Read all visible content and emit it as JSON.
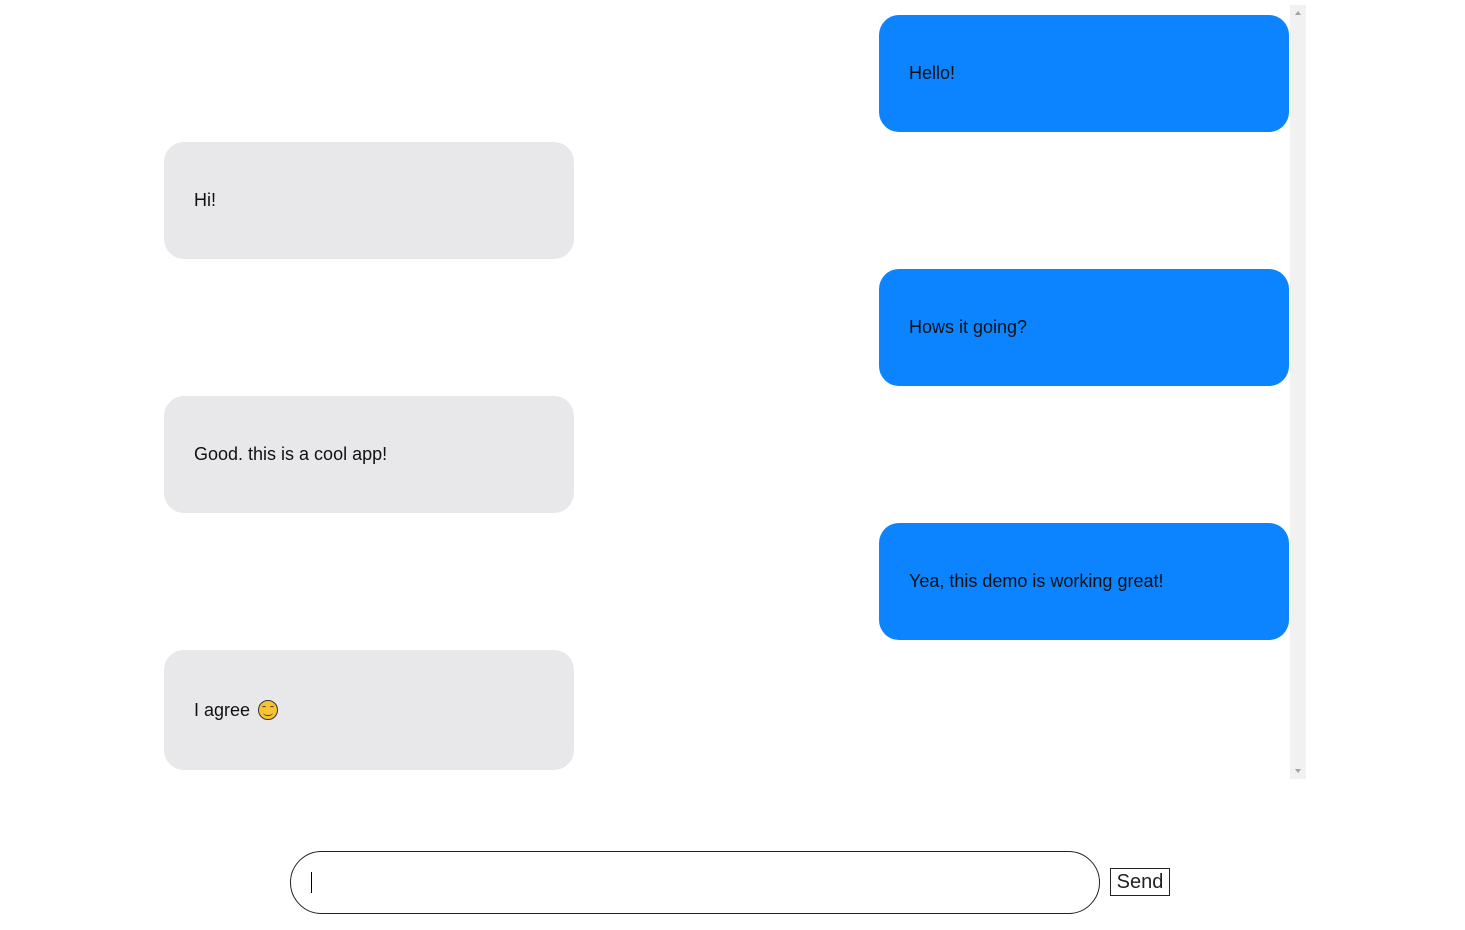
{
  "chat": {
    "messages": [
      {
        "direction": "outgoing",
        "text": "Hello!"
      },
      {
        "direction": "incoming",
        "text": "Hi!"
      },
      {
        "direction": "outgoing",
        "text": "Hows it going?"
      },
      {
        "direction": "incoming",
        "text": "Good. this is a cool app!"
      },
      {
        "direction": "outgoing",
        "text": "Yea, this demo is working great!"
      },
      {
        "direction": "incoming",
        "text": "I agree",
        "emoji": "smiling-face-emoji"
      }
    ]
  },
  "composer": {
    "input_value": "",
    "input_placeholder": "",
    "send_label": "Send"
  },
  "colors": {
    "outgoing_bubble": "#0d84ff",
    "incoming_bubble": "#e8e8ea"
  },
  "icons": {
    "scroll_up": "scroll-up-arrow-icon",
    "scroll_down": "scroll-down-arrow-icon"
  }
}
